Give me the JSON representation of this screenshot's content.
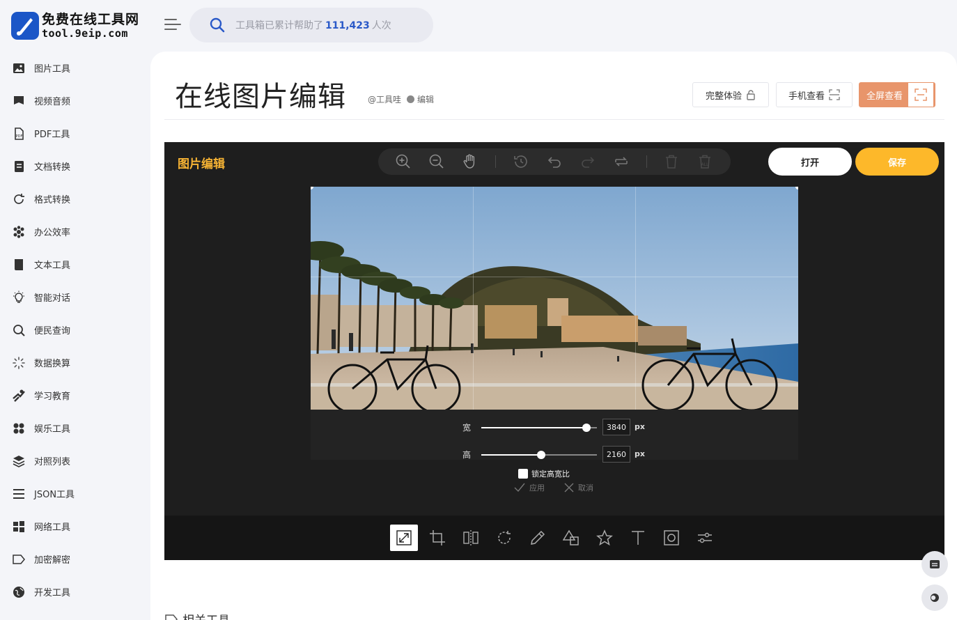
{
  "site": {
    "logo_name": "免费在线工具网",
    "logo_domain": "tool.9eip.com"
  },
  "header": {
    "menu_icon": "menu-icon",
    "search": {
      "prefix": "工具箱已累计帮助了",
      "count": "111,423",
      "suffix": "人次"
    }
  },
  "sidebar": {
    "items": [
      {
        "label": "图片工具",
        "icon": "image-icon"
      },
      {
        "label": "视频音频",
        "icon": "video-icon"
      },
      {
        "label": "PDF工具",
        "icon": "pdf-icon"
      },
      {
        "label": "文档转换",
        "icon": "document-icon"
      },
      {
        "label": "格式转换",
        "icon": "refresh-icon"
      },
      {
        "label": "办公效率",
        "icon": "office-icon"
      },
      {
        "label": "文本工具",
        "icon": "book-icon"
      },
      {
        "label": "智能对话",
        "icon": "lightbulb-icon"
      },
      {
        "label": "便民查询",
        "icon": "search-icon"
      },
      {
        "label": "数据换算",
        "icon": "spinner-icon"
      },
      {
        "label": "学习教育",
        "icon": "education-icon"
      },
      {
        "label": "娱乐工具",
        "icon": "apps-icon"
      },
      {
        "label": "对照列表",
        "icon": "layers-icon"
      },
      {
        "label": "JSON工具",
        "icon": "list-icon"
      },
      {
        "label": "网络工具",
        "icon": "windows-icon"
      },
      {
        "label": "加密解密",
        "icon": "tag-icon"
      },
      {
        "label": "开发工具",
        "icon": "globe-icon"
      }
    ]
  },
  "page": {
    "title": "在线图片编辑",
    "author": "@工具哇",
    "edit_label": "编辑",
    "buttons": {
      "full_experience": "完整体验",
      "mobile_view": "手机查看",
      "fullscreen": "全屏查看"
    }
  },
  "editor": {
    "title": "图片编辑",
    "open_label": "打开",
    "save_label": "保存",
    "toolbar_icons": [
      "zoom-in-icon",
      "zoom-out-icon",
      "hand-icon",
      "history-icon",
      "undo-icon",
      "redo-icon",
      "reset-icon",
      "delete-icon",
      "delete-all-icon"
    ],
    "resize": {
      "width_label": "宽",
      "width_value": "3840",
      "width_fraction": 0.91,
      "height_label": "高",
      "height_value": "2160",
      "height_fraction": 0.52,
      "unit": "px",
      "lock_label": "锁定高宽比",
      "apply_label": "应用",
      "cancel_label": "取消"
    },
    "bottom_tools": [
      "resize-icon",
      "crop-icon",
      "flip-icon",
      "rotate-icon",
      "draw-icon",
      "shape-icon",
      "star-icon",
      "text-icon",
      "mask-icon",
      "filter-icon"
    ]
  },
  "related": {
    "title": "相关工具"
  },
  "colors": {
    "accent_orange": "#e8956b",
    "save_yellow": "#fdb82a",
    "editor_title": "#f6b334",
    "search_count": "#2a59c8"
  }
}
